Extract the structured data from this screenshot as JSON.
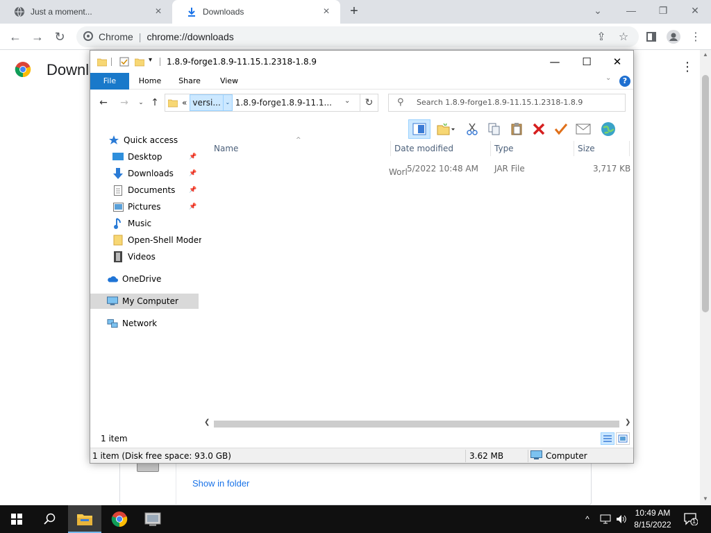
{
  "browser": {
    "tabs": [
      {
        "title": "Just a moment...",
        "icon": "globe-icon"
      },
      {
        "title": "Downloads",
        "icon": "download-icon"
      }
    ],
    "new_tab": "+",
    "omnibox": {
      "site_label": "Chrome",
      "separator": "|",
      "url": "chrome://downloads"
    },
    "page_title": "Downloads",
    "download_card": {
      "action_link": "Show in folder"
    }
  },
  "explorer": {
    "title": "1.8.9-forge1.8.9-11.15.1.2318-1.8.9",
    "ribbon_tabs": [
      "File",
      "Home",
      "Share",
      "View"
    ],
    "help_label": "?",
    "address": {
      "overflow": "«",
      "crumb_selected": "versi...",
      "crumb_current": "1.8.9-forge1.8.9-11.1..."
    },
    "search_placeholder": "Search 1.8.9-forge1.8.9-11.15.1.2318-1.8.9",
    "nav": {
      "quick_access": "Quick access",
      "items": [
        {
          "label": "Desktop",
          "icon": "desktop-icon",
          "pinned": true
        },
        {
          "label": "Downloads",
          "icon": "download-arrow-icon",
          "pinned": true
        },
        {
          "label": "Documents",
          "icon": "documents-icon",
          "pinned": true
        },
        {
          "label": "Pictures",
          "icon": "pictures-icon",
          "pinned": true
        },
        {
          "label": "Music",
          "icon": "music-icon",
          "pinned": false
        },
        {
          "label": "Open-Shell Modern",
          "icon": "folder-icon",
          "pinned": false
        },
        {
          "label": "Videos",
          "icon": "videos-icon",
          "pinned": false
        }
      ],
      "onedrive": "OneDrive",
      "my_computer": "My Computer",
      "network": "Network"
    },
    "columns": {
      "name": "Name",
      "date": "Date modified",
      "type": "Type",
      "size": "Size"
    },
    "file": {
      "name_fragment": "Worl",
      "date": "5/2022 10:48 AM",
      "type": "JAR File",
      "size": "3,717 KB"
    },
    "status": {
      "item_count": "1 item",
      "disk_info": "1 item (Disk free space: 93.0 GB)",
      "selection_size": "3.62 MB",
      "location": "Computer"
    }
  },
  "taskbar": {
    "time": "10:49 AM",
    "date": "8/15/2022",
    "notification_count": "1"
  },
  "colors": {
    "chrome_tabstrip": "#dee1e6",
    "explorer_file_tab": "#1979ca",
    "selection_blue": "#cce8ff",
    "taskbar": "#101010",
    "link_blue": "#1a73e8"
  }
}
